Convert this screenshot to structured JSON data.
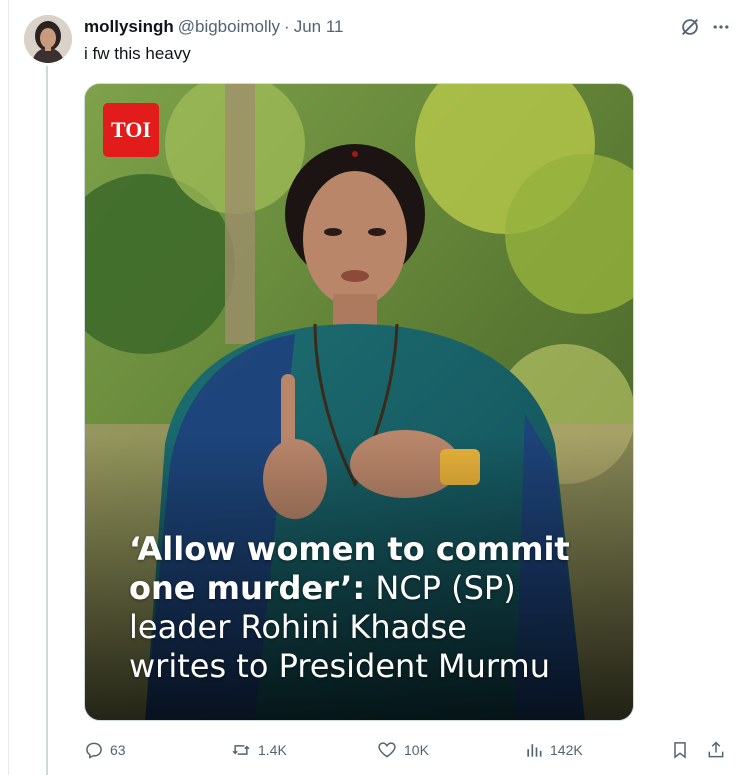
{
  "post": {
    "display_name": "mollysingh",
    "handle": "@bigboimolly",
    "separator": "·",
    "date": "Jun 11",
    "text": "i fw this heavy"
  },
  "header_icons": [
    "grok-icon",
    "more-icon"
  ],
  "media": {
    "logo_text": "TOI",
    "caption": {
      "line1": "‘Allow women to commit",
      "line2_bold": "one murder’:",
      "line2_rest": " NCP (SP)",
      "line3": "leader Rohini Khadse",
      "line4": "writes to President Murmu"
    }
  },
  "actions": {
    "replies": "63",
    "reposts": "1.4K",
    "likes": "10K",
    "views": "142K"
  },
  "colors": {
    "text_primary": "#0f1419",
    "text_secondary": "#536471",
    "border": "#cfd9de",
    "toi_red": "#e21b1b"
  }
}
